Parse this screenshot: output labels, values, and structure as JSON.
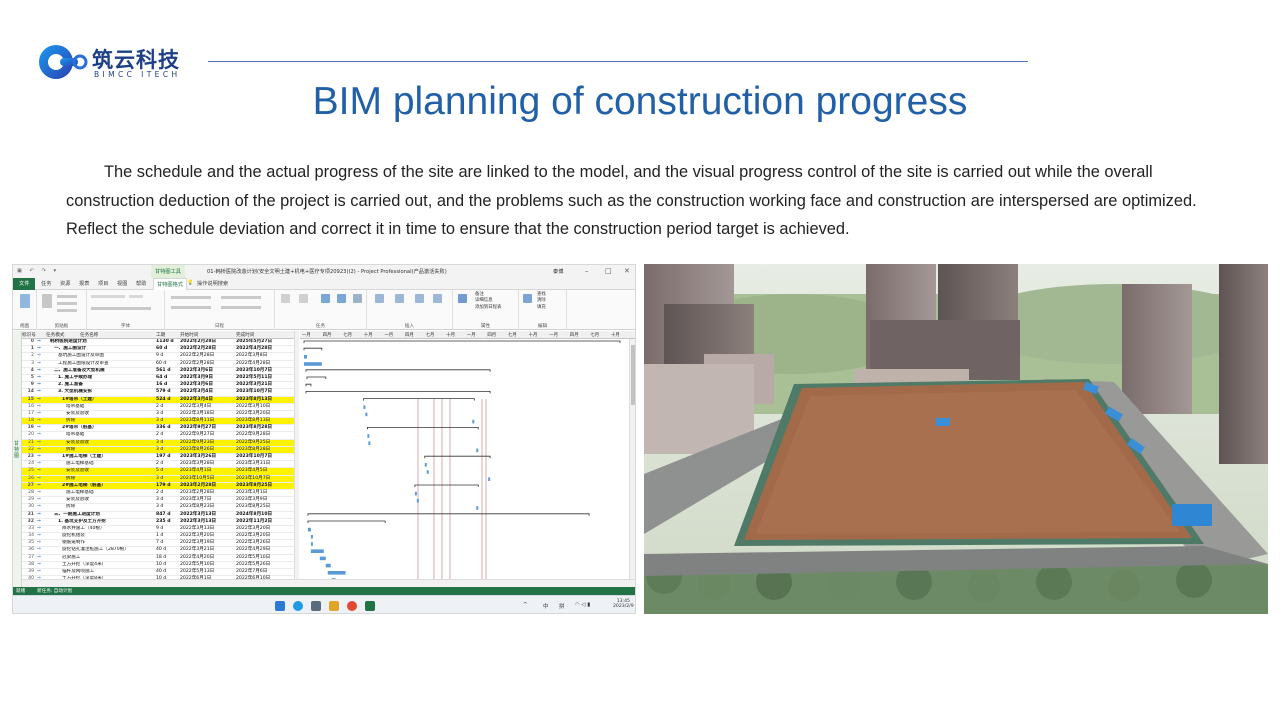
{
  "slide": {
    "logo_cn": "筑云科技",
    "logo_en": "BIMCC ITECH",
    "title": "BIM planning of construction progress",
    "body": "The schedule and the actual progress of the site are linked to the model, and the visual progress control of the site is carried out while the overall construction deduction of the project is carried out, and the problems such as the construction working face and construction are interspersed are optimized. Reflect the schedule deviation and correct it in time to ensure that the construction period target is achieved."
  },
  "project_window": {
    "title": "01-韩桥医院改造计划(安全文明土建+机电+医疗专项20923)(2) - Project Professional(产品激活失败)",
    "context_tab": "甘特图工具",
    "user": "秦博",
    "tabs": [
      "文件",
      "任务",
      "资源",
      "报表",
      "项目",
      "视图",
      "帮助",
      "甘特图格式"
    ],
    "search_placeholder": "操作说明搜索",
    "ribbon_groups": [
      "视图",
      "剪贴板",
      "字体",
      "日程",
      "任务",
      "插入",
      "属性",
      "编辑"
    ],
    "ribbon_right_items": [
      "备注",
      "详细信息",
      "添加到日程表",
      "查找",
      "清除",
      "填充"
    ],
    "side_label": "甘特图",
    "columns": [
      "标识号",
      "任务模式",
      "任务名称",
      "工期",
      "开始时间",
      "完成时间"
    ],
    "gantt_periods": [
      "一月",
      "四月",
      "七月",
      "十月",
      "一月",
      "四月",
      "七月",
      "十月",
      "一月",
      "四月",
      "七月",
      "十月",
      "一月",
      "四月",
      "七月",
      "十月"
    ],
    "status_left": "就绪",
    "status_new_tasks": "新任务: 自动计划",
    "taskbar_tray": [
      "中",
      "拼"
    ],
    "clock_time": "13:45",
    "clock_date": "2023/2/9",
    "tasks": [
      {
        "id": "0",
        "name": "韩桥医院进度计划",
        "dur": "1130 d",
        "start": "2022年2月28日",
        "finish": "2025年5月27日",
        "summary": true,
        "hl": false,
        "indent": 0,
        "bar": [
          0,
          330
        ]
      },
      {
        "id": "1",
        "name": "一、施工图设计",
        "dur": "60 d",
        "start": "2022年2月28日",
        "finish": "2022年4月28日",
        "summary": true,
        "hl": false,
        "indent": 1,
        "bar": [
          0,
          18
        ]
      },
      {
        "id": "2",
        "name": "基坑施工图设计及审图",
        "dur": "9 d",
        "start": "2022年2月28日",
        "finish": "2022年3月8日",
        "summary": false,
        "hl": false,
        "indent": 2,
        "bar": [
          0,
          3
        ]
      },
      {
        "id": "3",
        "name": "工程施工图纸设计及审查",
        "dur": "60 d",
        "start": "2022年2月28日",
        "finish": "2022年4月28日",
        "summary": false,
        "hl": false,
        "indent": 2,
        "bar": [
          0,
          18
        ]
      },
      {
        "id": "4",
        "name": "二、施工准备及大型机械",
        "dur": "561 d",
        "start": "2022年3月6日",
        "finish": "2023年10月7日",
        "summary": true,
        "hl": false,
        "indent": 1,
        "bar": [
          2,
          188
        ]
      },
      {
        "id": "5",
        "name": "1. 施工手续办理",
        "dur": "64 d",
        "start": "2022年3月9日",
        "finish": "2022年5月11日",
        "summary": true,
        "hl": false,
        "indent": 2,
        "bar": [
          3,
          22
        ]
      },
      {
        "id": "9",
        "name": "2. 施工准备",
        "dur": "16 d",
        "start": "2022年3月6日",
        "finish": "2022年3月21日",
        "summary": true,
        "hl": false,
        "indent": 2,
        "bar": [
          2,
          7
        ]
      },
      {
        "id": "14",
        "name": "3. 大型机械安拆",
        "dur": "579 d",
        "start": "2022年3月4日",
        "finish": "2023年10月7日",
        "summary": true,
        "hl": false,
        "indent": 2,
        "bar": [
          2,
          188
        ]
      },
      {
        "id": "15",
        "name": "1#塔吊（土建）",
        "dur": "524 d",
        "start": "2022年3月4日",
        "finish": "2023年8月13日",
        "summary": true,
        "hl": true,
        "indent": 3,
        "bar": [
          60,
          172
        ]
      },
      {
        "id": "16",
        "name": "塔吊基础",
        "dur": "2 d",
        "start": "2022年3月4日",
        "finish": "2022年3月10日",
        "summary": false,
        "hl": false,
        "indent": 4,
        "bar": [
          60,
          62
        ]
      },
      {
        "id": "17",
        "name": "安装及验收",
        "dur": "3 d",
        "start": "2022年3月18日",
        "finish": "2022年3月20日",
        "summary": false,
        "hl": false,
        "indent": 4,
        "bar": [
          62,
          64
        ]
      },
      {
        "id": "18",
        "name": "拆除",
        "dur": "3 d",
        "start": "2023年8月11日",
        "finish": "2023年8月13日",
        "summary": false,
        "hl": true,
        "indent": 4,
        "bar": [
          170,
          172
        ]
      },
      {
        "id": "19",
        "name": "2#塔吊（桩基）",
        "dur": "336 d",
        "start": "2022年9月27日",
        "finish": "2023年8月28日",
        "summary": true,
        "hl": false,
        "indent": 3,
        "bar": [
          64,
          176
        ]
      },
      {
        "id": "20",
        "name": "塔吊基础",
        "dur": "2 d",
        "start": "2022年9月27日",
        "finish": "2022年9月28日",
        "summary": false,
        "hl": false,
        "indent": 4,
        "bar": [
          64,
          66
        ]
      },
      {
        "id": "21",
        "name": "安装及验收",
        "dur": "3 d",
        "start": "2022年9月23日",
        "finish": "2022年9月25日",
        "summary": false,
        "hl": true,
        "indent": 4,
        "bar": [
          65,
          67
        ]
      },
      {
        "id": "22",
        "name": "拆除",
        "dur": "3 d",
        "start": "2023年8月26日",
        "finish": "2023年8月28日",
        "summary": false,
        "hl": true,
        "indent": 4,
        "bar": [
          174,
          176
        ]
      },
      {
        "id": "23",
        "name": "1#施工电梯（土建）",
        "dur": "197 d",
        "start": "2023年3月26日",
        "finish": "2023年10月7日",
        "summary": true,
        "hl": false,
        "indent": 3,
        "bar": [
          122,
          188
        ]
      },
      {
        "id": "24",
        "name": "施工电梯基础",
        "dur": "2 d",
        "start": "2023年3月28日",
        "finish": "2023年3月31日",
        "summary": false,
        "hl": false,
        "indent": 4,
        "bar": [
          122,
          124
        ]
      },
      {
        "id": "25",
        "name": "安装及验收",
        "dur": "5 d",
        "start": "2023年4月1日",
        "finish": "2023年4月5日",
        "summary": false,
        "hl": true,
        "indent": 4,
        "bar": [
          124,
          126
        ]
      },
      {
        "id": "26",
        "name": "拆除",
        "dur": "3 d",
        "start": "2023年10月5日",
        "finish": "2023年10月7日",
        "summary": false,
        "hl": true,
        "indent": 4,
        "bar": [
          186,
          188
        ]
      },
      {
        "id": "27",
        "name": "2#施工电梯（桩基）",
        "dur": "179 d",
        "start": "2023年2月28日",
        "finish": "2023年8月25日",
        "summary": true,
        "hl": true,
        "indent": 3,
        "bar": [
          112,
          176
        ]
      },
      {
        "id": "28",
        "name": "施工电梯基础",
        "dur": "2 d",
        "start": "2023年2月28日",
        "finish": "2023年3月1日",
        "summary": false,
        "hl": false,
        "indent": 4,
        "bar": [
          112,
          114
        ]
      },
      {
        "id": "29",
        "name": "安装及验收",
        "dur": "3 d",
        "start": "2023年3月7日",
        "finish": "2023年3月9日",
        "summary": false,
        "hl": false,
        "indent": 4,
        "bar": [
          114,
          116
        ]
      },
      {
        "id": "30",
        "name": "拆除",
        "dur": "3 d",
        "start": "2023年8月23日",
        "finish": "2023年8月25日",
        "summary": false,
        "hl": false,
        "indent": 4,
        "bar": [
          174,
          176
        ]
      },
      {
        "id": "31",
        "name": "三、一期施工进度计划",
        "dur": "847 d",
        "start": "2022年3月13日",
        "finish": "2024年8月10日",
        "summary": true,
        "hl": false,
        "indent": 1,
        "bar": [
          4,
          288
        ]
      },
      {
        "id": "32",
        "name": "1. 基坑支护及土方开挖",
        "dur": "235 d",
        "start": "2022年3月13日",
        "finish": "2022年11月2日",
        "summary": true,
        "hl": false,
        "indent": 2,
        "bar": [
          4,
          82
        ]
      },
      {
        "id": "33",
        "name": "降水井施工（40根）",
        "dur": "9 d",
        "start": "2022年3月13日",
        "finish": "2022年3月20日",
        "summary": false,
        "hl": false,
        "indent": 3,
        "bar": [
          4,
          7
        ]
      },
      {
        "id": "34",
        "name": "旋挖机组装",
        "dur": "1 d",
        "start": "2022年3月20日",
        "finish": "2022年3月20日",
        "summary": false,
        "hl": false,
        "indent": 3,
        "bar": [
          7,
          8
        ]
      },
      {
        "id": "35",
        "name": "钢筋笼制作",
        "dur": "7 d",
        "start": "2022年3月19日",
        "finish": "2022年3月26日",
        "summary": false,
        "hl": false,
        "indent": 3,
        "bar": [
          7,
          9
        ]
      },
      {
        "id": "36",
        "name": "旋挖钻孔灌注桩施工（2870根）",
        "dur": "40 d",
        "start": "2022年3月21日",
        "finish": "2022年4月29日",
        "summary": false,
        "hl": false,
        "indent": 3,
        "bar": [
          7,
          20
        ]
      },
      {
        "id": "37",
        "name": "冠梁施工",
        "dur": "18 d",
        "start": "2022年4月20日",
        "finish": "2022年5月10日",
        "summary": false,
        "hl": false,
        "indent": 3,
        "bar": [
          16,
          22
        ]
      },
      {
        "id": "38",
        "name": "土方开挖（深度4米）",
        "dur": "10 d",
        "start": "2022年5月10日",
        "finish": "2022年5月26日",
        "summary": false,
        "hl": false,
        "indent": 3,
        "bar": [
          22,
          27
        ]
      },
      {
        "id": "39",
        "name": "锚杆及网喷施工",
        "dur": "40 d",
        "start": "2022年5月13日",
        "finish": "2022年7月6日",
        "summary": false,
        "hl": false,
        "indent": 3,
        "bar": [
          24,
          42
        ]
      },
      {
        "id": "40",
        "name": "土方开挖（深度8米）",
        "dur": "10 d",
        "start": "2022年6月1日",
        "finish": "2022年6月10日",
        "summary": false,
        "hl": false,
        "indent": 3,
        "bar": [
          28,
          32
        ]
      }
    ]
  },
  "colors": {
    "title_blue": "#2160a7",
    "logo_blue": "#1d3f86",
    "project_green": "#217346",
    "highlight_yellow": "#fdf200",
    "gantt_bar": "#5b9bd5",
    "site_ground": "#a36a4a"
  }
}
